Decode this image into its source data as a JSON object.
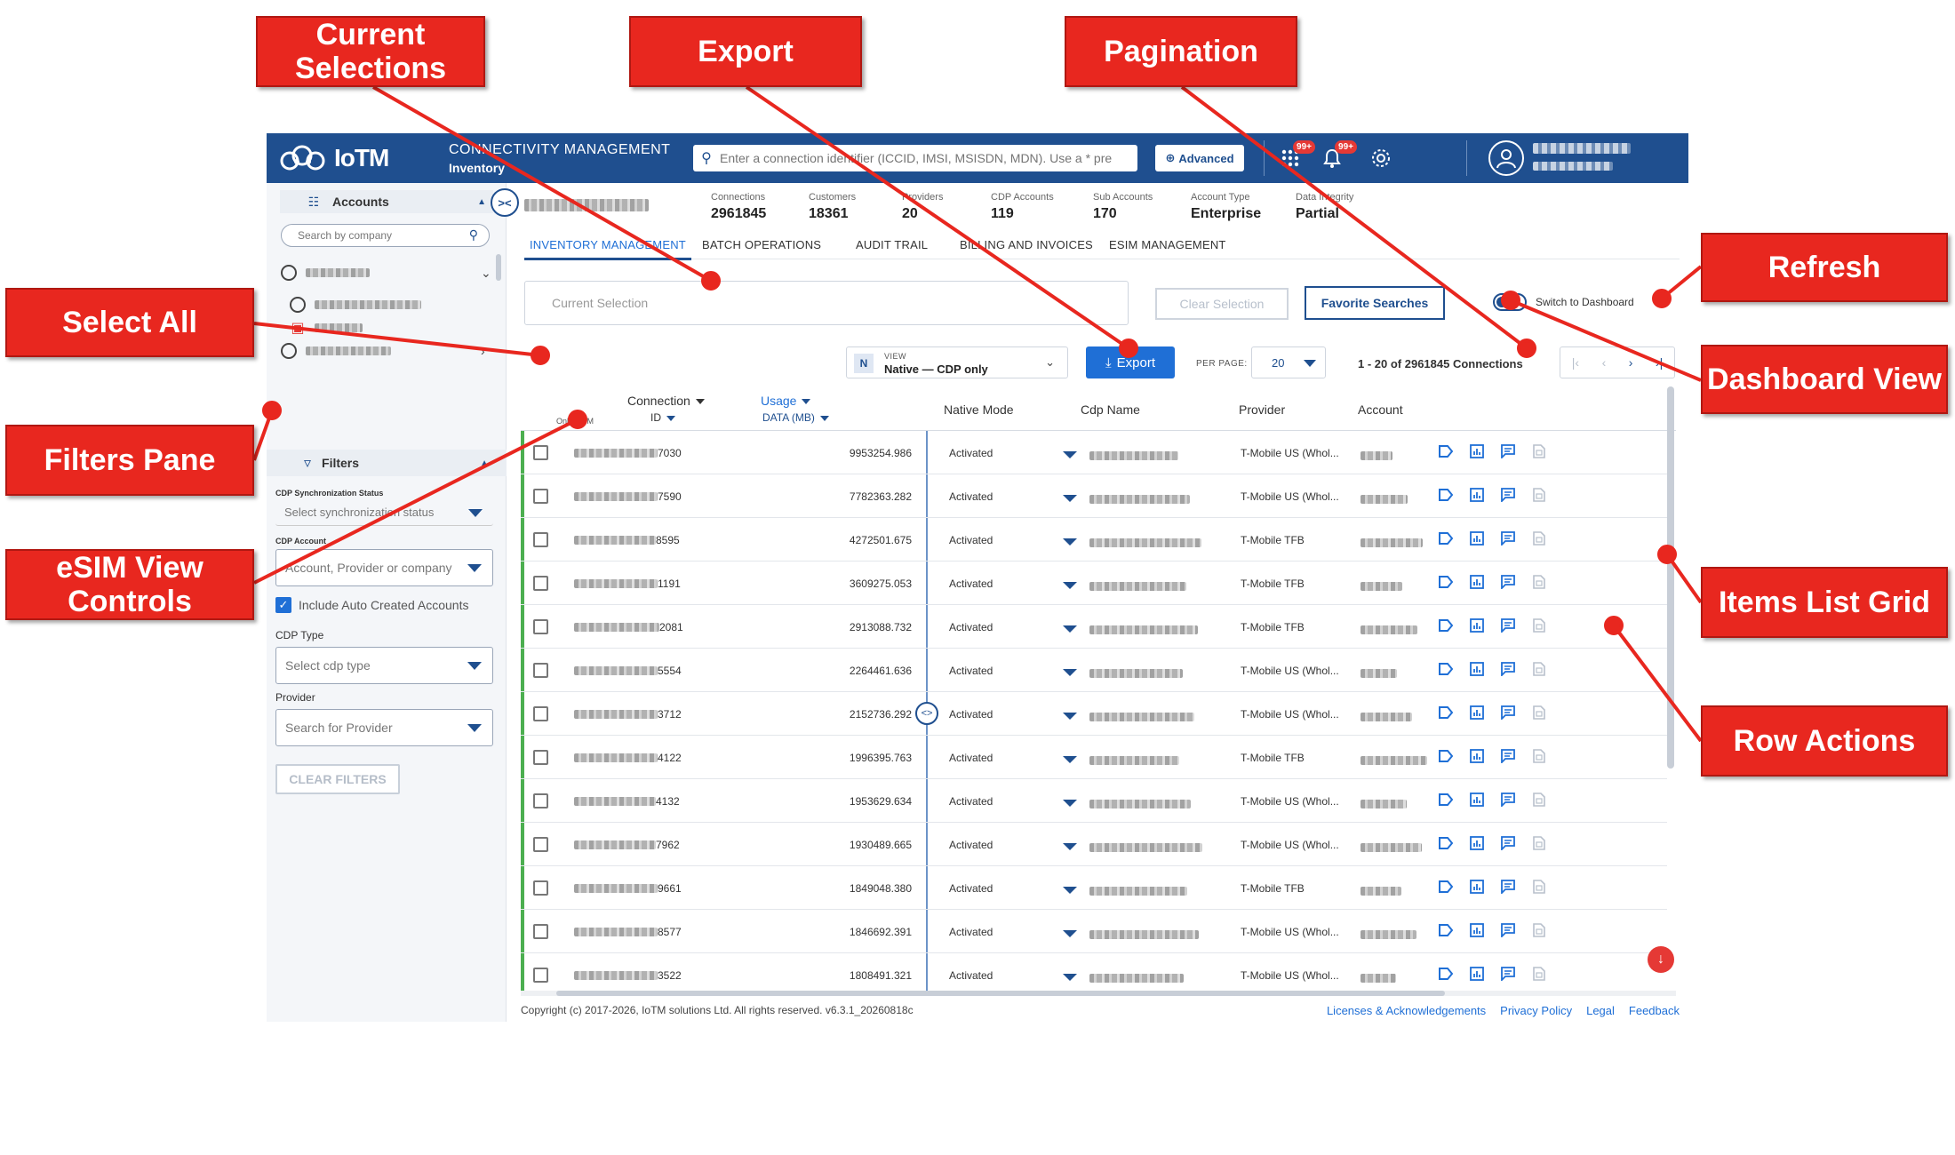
{
  "callouts": {
    "current_selections": "Current Selections",
    "export": "Export",
    "pagination": "Pagination",
    "refresh": "Refresh",
    "select_all": "Select All",
    "dashboard_view": "Dashboard View",
    "filters_pane": "Filters Pane",
    "esim_view_controls": "eSIM View Controls",
    "items_list_grid": "Items List Grid",
    "row_actions": "Row Actions"
  },
  "topbar": {
    "brand": "IoTM",
    "product_title": "CONNECTIVITY MANAGEMENT",
    "product_subtitle": "Inventory",
    "search_placeholder": "Enter a connection identifier (ICCID, IMSI, MSISDN, MDN). Use a * pre",
    "advanced_label": "Advanced",
    "apps_badge": "99+",
    "notifications_badge": "99+"
  },
  "sidebar": {
    "accounts_label": "Accounts",
    "company_search_placeholder": "Search by company",
    "filters_label": "Filters",
    "cdp_sync_label": "CDP Synchronization Status",
    "cdp_sync_placeholder": "Select synchronization status",
    "cdp_account_label": "CDP Account",
    "cdp_account_placeholder": "Account, Provider or company",
    "include_auto_label": "Include Auto Created Accounts",
    "cdp_type_label": "CDP Type",
    "cdp_type_placeholder": "Select cdp type",
    "provider_label": "Provider",
    "provider_placeholder": "Search for Provider",
    "clear_filters_label": "CLEAR FILTERS"
  },
  "stats": [
    {
      "label": "Connections",
      "value": "2961845"
    },
    {
      "label": "Customers",
      "value": "18361"
    },
    {
      "label": "Providers",
      "value": "20"
    },
    {
      "label": "CDP Accounts",
      "value": "119"
    },
    {
      "label": "Sub Accounts",
      "value": "170"
    },
    {
      "label": "Account Type",
      "value": "Enterprise"
    },
    {
      "label": "Data Integrity",
      "value": "Partial"
    }
  ],
  "tabs": [
    {
      "label": "INVENTORY MANAGEMENT",
      "active": true
    },
    {
      "label": "BATCH OPERATIONS",
      "active": false
    },
    {
      "label": "AUDIT TRAIL",
      "active": false
    },
    {
      "label": "BILLING AND INVOICES",
      "active": false
    },
    {
      "label": "ESIM MANAGEMENT",
      "active": false
    }
  ],
  "selection": {
    "current_placeholder": "Current Selection",
    "clear_label": "Clear Selection",
    "favorites_label": "Favorite Searches",
    "switch_label": "Switch to Dashboard"
  },
  "toolbar": {
    "view_badge": "N",
    "view_label": "VIEW",
    "view_value": "Native — CDP only",
    "export_label": "Export",
    "per_page_label": "PER PAGE:",
    "per_page_value": "20",
    "range_text": "1 - 20 of 2961845 Connections"
  },
  "grid": {
    "col_connection": "Connection",
    "col_id": "ID",
    "col_only_esim": "Only eSIM",
    "col_usage": "Usage",
    "col_data_mb": "DATA (MB)",
    "col_native_mode": "Native Mode",
    "col_cdp_name": "Cdp Name",
    "col_provider": "Provider",
    "col_account": "Account",
    "rows": [
      {
        "id_suffix": "7030",
        "usage": "9953254.986",
        "mode": "Activated",
        "provider": "T-Mobile US (Whol..."
      },
      {
        "id_suffix": "7590",
        "usage": "7782363.282",
        "mode": "Activated",
        "provider": "T-Mobile US (Whol..."
      },
      {
        "id_suffix": "8595",
        "usage": "4272501.675",
        "mode": "Activated",
        "provider": "T-Mobile TFB"
      },
      {
        "id_suffix": "1191",
        "usage": "3609275.053",
        "mode": "Activated",
        "provider": "T-Mobile TFB"
      },
      {
        "id_suffix": "2081",
        "usage": "2913088.732",
        "mode": "Activated",
        "provider": "T-Mobile TFB"
      },
      {
        "id_suffix": "5554",
        "usage": "2264461.636",
        "mode": "Activated",
        "provider": "T-Mobile US (Whol..."
      },
      {
        "id_suffix": "3712",
        "usage": "2152736.292",
        "mode": "Activated",
        "provider": "T-Mobile US (Whol..."
      },
      {
        "id_suffix": "4122",
        "usage": "1996395.763",
        "mode": "Activated",
        "provider": "T-Mobile TFB"
      },
      {
        "id_suffix": "4132",
        "usage": "1953629.634",
        "mode": "Activated",
        "provider": "T-Mobile US (Whol..."
      },
      {
        "id_suffix": "7962",
        "usage": "1930489.665",
        "mode": "Activated",
        "provider": "T-Mobile US (Whol..."
      },
      {
        "id_suffix": "9661",
        "usage": "1849048.380",
        "mode": "Activated",
        "provider": "T-Mobile TFB"
      },
      {
        "id_suffix": "8577",
        "usage": "1846692.391",
        "mode": "Activated",
        "provider": "T-Mobile US (Whol..."
      },
      {
        "id_suffix": "3522",
        "usage": "1808491.321",
        "mode": "Activated",
        "provider": "T-Mobile US (Whol..."
      }
    ]
  },
  "footer": {
    "copyright": "Copyright (c) 2017-2026, IoTM solutions Ltd. All rights reserved. v6.3.1_20260818c",
    "links": [
      "Licenses & Acknowledgements",
      "Privacy Policy",
      "Legal",
      "Feedback"
    ]
  },
  "colors": {
    "brand_blue": "#1f4f8f",
    "accent_blue": "#1f6fd6",
    "callout_red": "#e8271f",
    "status_green": "#4caf50"
  }
}
